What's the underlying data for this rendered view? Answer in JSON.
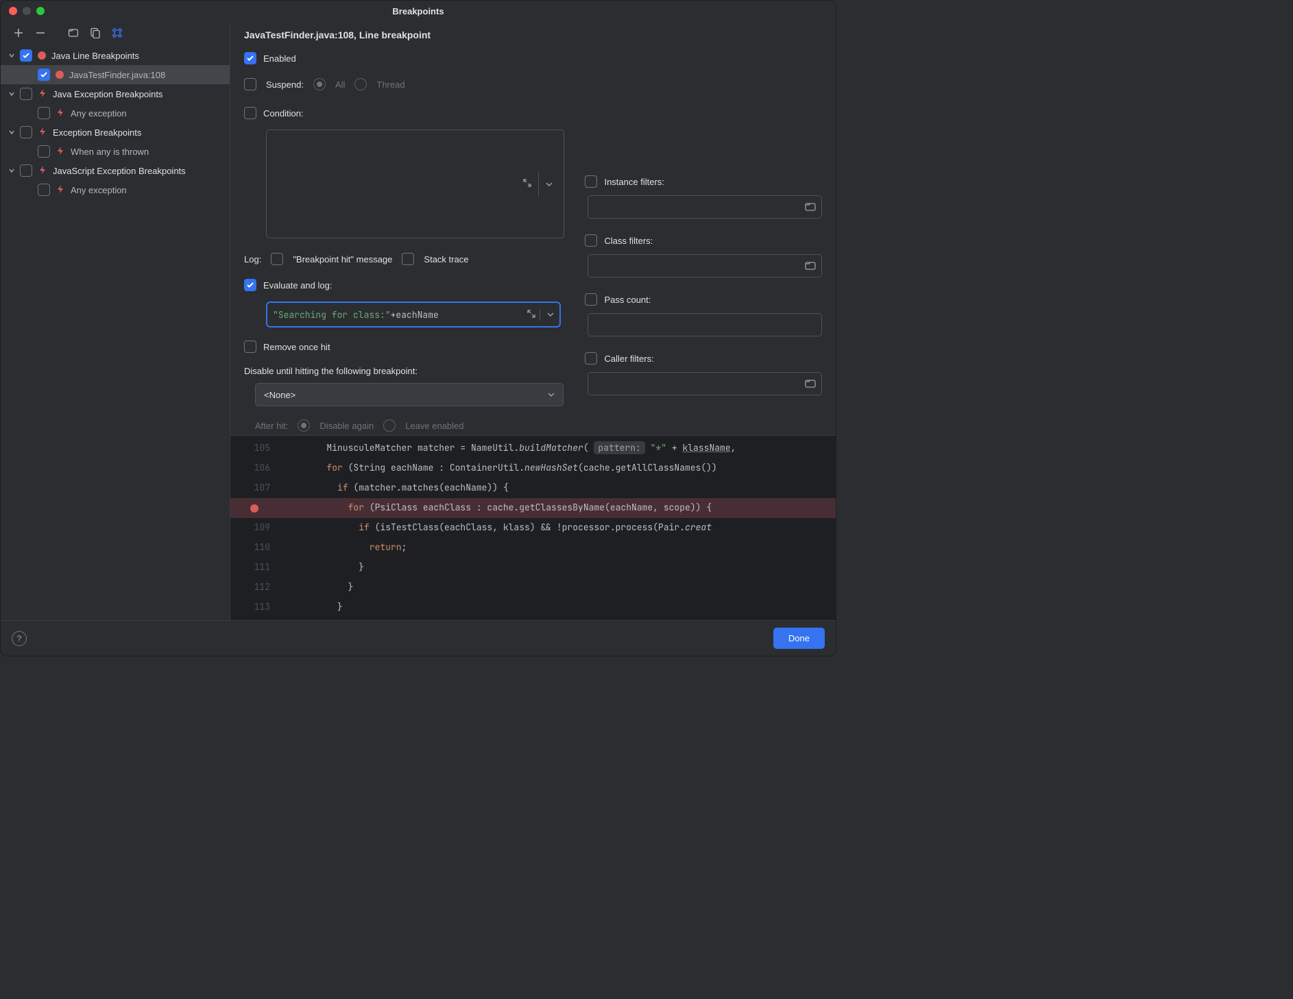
{
  "window": {
    "title": "Breakpoints"
  },
  "toolbar": {
    "add": "+",
    "remove": "−"
  },
  "tree": [
    {
      "kind": "group",
      "check": true,
      "icon": "dot",
      "label": "Java Line Breakpoints"
    },
    {
      "kind": "child",
      "check": true,
      "icon": "dot",
      "label": "JavaTestFinder.java:108",
      "selected": true
    },
    {
      "kind": "group",
      "check": false,
      "icon": "bolt",
      "label": "Java Exception Breakpoints"
    },
    {
      "kind": "child",
      "check": false,
      "icon": "bolt",
      "label": "Any exception"
    },
    {
      "kind": "group",
      "check": false,
      "icon": "bolt",
      "label": "Exception Breakpoints"
    },
    {
      "kind": "child",
      "check": false,
      "icon": "bolt",
      "label": "When any is thrown"
    },
    {
      "kind": "group",
      "check": false,
      "icon": "bolt",
      "label": "JavaScript Exception Breakpoints"
    },
    {
      "kind": "child",
      "check": false,
      "icon": "bolt",
      "label": "Any exception"
    }
  ],
  "detail_title": "JavaTestFinder.java:108, Line breakpoint",
  "enabled": {
    "label": "Enabled",
    "checked": true
  },
  "suspend": {
    "label": "Suspend:",
    "checked": false,
    "option_all": "All",
    "option_thread": "Thread"
  },
  "condition": {
    "label": "Condition:",
    "checked": false,
    "value": ""
  },
  "log": {
    "label": "Log:",
    "hit": {
      "label": "\"Breakpoint hit\" message",
      "checked": false
    },
    "stack": {
      "label": "Stack trace",
      "checked": false
    }
  },
  "eval": {
    "label": "Evaluate and log:",
    "checked": true,
    "expr_str": "\"Searching for class:\"",
    "expr_op": " + ",
    "expr_var": "eachName"
  },
  "remove_once": {
    "label": "Remove once hit",
    "checked": false
  },
  "disable_until": {
    "label": "Disable until hitting the following breakpoint:",
    "value": "<None>"
  },
  "after_hit": {
    "label": "After hit:",
    "disable_again": "Disable again",
    "leave_enabled": "Leave enabled"
  },
  "filters": {
    "instance": "Instance filters:",
    "class": "Class filters:",
    "pass": "Pass count:",
    "caller": "Caller filters:"
  },
  "code": {
    "lines": [
      {
        "n": "105",
        "i": 8,
        "html": "MinusculeMatcher matcher = NameUtil.<span class='it'>buildMatcher</span>( <span class='param-hint'>pattern:</span> <span class='str'>\"*\"</span> + <span class='ul'>klassName</span>,"
      },
      {
        "n": "106",
        "i": 8,
        "html": "<span class='kw'>for</span> (String eachName : ContainerUtil.<span class='it'>newHashSet</span>(cache.getAllClassNames())"
      },
      {
        "n": "107",
        "i": 10,
        "html": "<span class='kw'>if</span> (matcher.matches(eachName)) {"
      },
      {
        "n": "",
        "i": 12,
        "bp": true,
        "html": "<span class='kw'>for</span> (PsiClass eachClass : cache.getClassesByName(eachName, scope)) {"
      },
      {
        "n": "109",
        "i": 14,
        "html": "<span class='kw'>if</span> (isTestClass(eachClass, klass) && !processor.process(Pair.<span class='it'>creat</span>"
      },
      {
        "n": "110",
        "i": 16,
        "html": "<span class='kw'>return</span>;"
      },
      {
        "n": "111",
        "i": 14,
        "html": "}"
      },
      {
        "n": "112",
        "i": 12,
        "html": "}"
      },
      {
        "n": "113",
        "i": 10,
        "html": "}"
      }
    ]
  },
  "footer": {
    "done": "Done"
  }
}
